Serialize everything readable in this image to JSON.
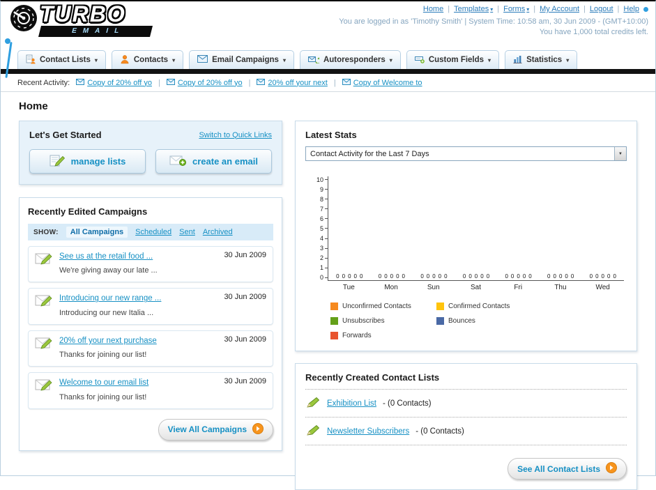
{
  "header": {
    "logo_line1": "TURBO",
    "logo_line2": "EMAIL",
    "nav": [
      "Home",
      "Templates",
      "Forms",
      "My Account",
      "Logout",
      "Help"
    ],
    "login_info": "You are logged in as 'Timothy Smith' | System Time: 10:58 am, 30 Jun 2009 - (GMT+10:00)",
    "credits": "You have 1,000 total credits left."
  },
  "tabs": [
    {
      "label": "Contact Lists"
    },
    {
      "label": "Contacts"
    },
    {
      "label": "Email Campaigns"
    },
    {
      "label": "Autoresponders"
    },
    {
      "label": "Custom Fields"
    },
    {
      "label": "Statistics"
    }
  ],
  "activity": {
    "label": "Recent Activity:",
    "items": [
      {
        "text": "Copy of 20% off yo"
      },
      {
        "text": "Copy of 20% off yo"
      },
      {
        "text": "20% off your next"
      },
      {
        "text": "Copy of Welcome to"
      }
    ]
  },
  "page_title": "Home",
  "get_started": {
    "title": "Let's Get Started",
    "switch_link": "Switch to Quick Links",
    "manage_lists": "manage lists",
    "create_email": "create an email"
  },
  "campaigns": {
    "title": "Recently Edited Campaigns",
    "show_label": "SHOW:",
    "filters": [
      {
        "label": "All Campaigns",
        "active": true
      },
      {
        "label": "Scheduled",
        "active": false
      },
      {
        "label": "Sent",
        "active": false
      },
      {
        "label": "Archived",
        "active": false
      }
    ],
    "items": [
      {
        "title": "See us at the retail food ...",
        "subtitle": "We're giving away our late ...",
        "date": "30 Jun 2009"
      },
      {
        "title": "Introducing our new range ...",
        "subtitle": "Introducing our new Italia ...",
        "date": "30 Jun 2009"
      },
      {
        "title": "20% off your next purchase",
        "subtitle": "Thanks for joining our list!",
        "date": "30 Jun 2009"
      },
      {
        "title": "Welcome to our email list",
        "subtitle": "Thanks for joining our list!",
        "date": "30 Jun 2009"
      }
    ],
    "view_all": "View All Campaigns"
  },
  "stats": {
    "title": "Latest Stats",
    "period": "Contact Activity for the Last 7 Days"
  },
  "contact_lists": {
    "title": "Recently Created Contact Lists",
    "items": [
      {
        "name": "Exhibition List",
        "suffix": "- (0 Contacts)"
      },
      {
        "name": "Newsletter Subscribers",
        "suffix": "- (0 Contacts)"
      }
    ],
    "see_all": "See All Contact Lists"
  },
  "chart_data": {
    "type": "bar",
    "title": "Contact Activity for the Last 7 Days",
    "categories": [
      "Tue",
      "Mon",
      "Sun",
      "Sat",
      "Fri",
      "Thu",
      "Wed"
    ],
    "series": [
      {
        "name": "Unconfirmed Contacts",
        "color": "#f6891f",
        "values": [
          0,
          0,
          0,
          0,
          0,
          0,
          0
        ]
      },
      {
        "name": "Confirmed Contacts",
        "color": "#ffc40d",
        "values": [
          0,
          0,
          0,
          0,
          0,
          0,
          0
        ]
      },
      {
        "name": "Unsubscribes",
        "color": "#64a019",
        "values": [
          0,
          0,
          0,
          0,
          0,
          0,
          0
        ]
      },
      {
        "name": "Bounces",
        "color": "#4a69a5",
        "values": [
          0,
          0,
          0,
          0,
          0,
          0,
          0
        ]
      },
      {
        "name": "Forwards",
        "color": "#e8542e",
        "values": [
          0,
          0,
          0,
          0,
          0,
          0,
          0
        ]
      }
    ],
    "ylim": [
      0,
      10
    ],
    "xlabel": "",
    "ylabel": "",
    "grid": false,
    "legend_position": "bottom"
  },
  "colors": {
    "link": "#1690c4",
    "top_nav_link": "#2b7cba",
    "tab_stripe": "#121212",
    "accent_orange": "#f7941d",
    "panel_blue_bg": "#e7f2fa"
  },
  "icons": {
    "speedometer": "gauge",
    "envelope": "✉",
    "pencil": "✎",
    "plus": "+",
    "chevron_down": "▾",
    "arrow_right_circle": "➔",
    "person": "👤",
    "bar_chart": "📊"
  }
}
